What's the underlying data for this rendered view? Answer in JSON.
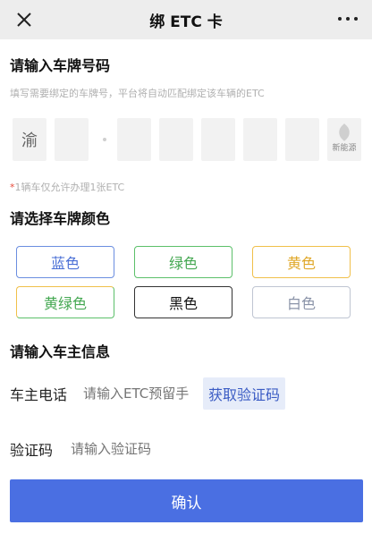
{
  "header": {
    "title": "绑 ETC 卡"
  },
  "plate_section": {
    "title": "请输入车牌号码",
    "hint": "填写需要绑定的车牌号，平台将自动匹配绑定该车辆的ETC",
    "first_char": "渝",
    "new_energy_label": "新能源",
    "note_star": "*",
    "note": "1辆车仅允许办理1张ETC"
  },
  "color_section": {
    "title": "请选择车牌颜色",
    "options": [
      "蓝色",
      "绿色",
      "黄色",
      "黄绿色",
      "黑色",
      "白色"
    ]
  },
  "owner_section": {
    "title": "请输入车主信息",
    "phone_label": "车主电话",
    "phone_placeholder": "请输入ETC预留手机号",
    "get_code_label": "获取验证码",
    "code_label": "验证码",
    "code_placeholder": "请输入验证码"
  },
  "confirm_label": "确认"
}
